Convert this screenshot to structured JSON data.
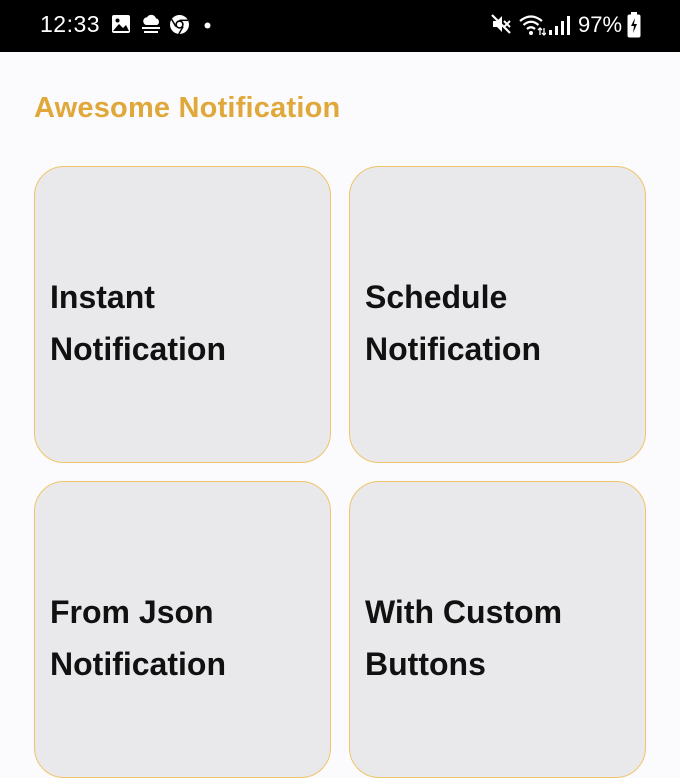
{
  "status_bar": {
    "time": "12:33",
    "battery_percent": "97%",
    "left_icons": [
      "gallery-icon",
      "cloud-icon",
      "chrome-icon",
      "dot-icon"
    ],
    "right_icons": [
      "mute-icon",
      "wifi-icon",
      "signal-icon",
      "battery-charging-icon"
    ]
  },
  "app": {
    "title": "Awesome Notification",
    "accent_color": "#e0a83a",
    "card_border_color": "#efc56a",
    "card_background": "#e9e8eb"
  },
  "cards": [
    {
      "label": "Instant\nNotification"
    },
    {
      "label": "Schedule\nNotification"
    },
    {
      "label": "From Json\nNotification"
    },
    {
      "label": "With Custom\nButtons"
    }
  ]
}
